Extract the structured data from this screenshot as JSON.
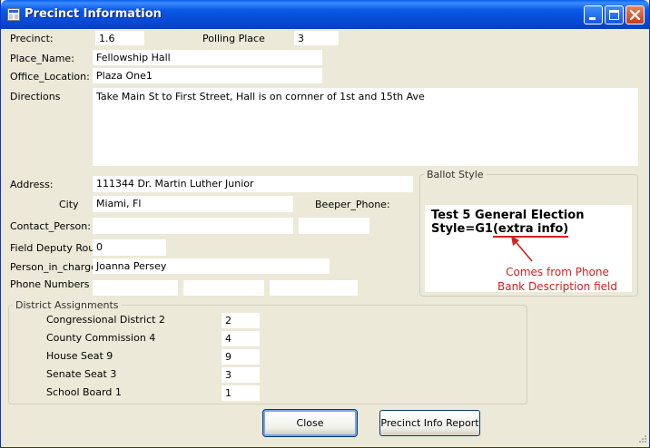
{
  "window": {
    "title": "Precinct Information"
  },
  "labels": {
    "precinct": "Precinct:",
    "polling_place": "Polling Place",
    "place_name": "Place_Name:",
    "office_location": "Office_Location:",
    "directions": "Directions",
    "address": "Address:",
    "city": "City",
    "beeper_phone": "Beeper_Phone:",
    "contact_person": "Contact_Person:",
    "field_deputy_route": "Field Deputy Route:",
    "person_in_charge": "Person_in_charge:",
    "phone_numbers": "Phone Numbers"
  },
  "fields": {
    "precinct": "1.6",
    "polling_place": "3",
    "place_name": "Fellowship Hall",
    "office_location": "Plaza One1",
    "directions": "Take Main St to First Street, Hall is on cornner of 1st and 15th Ave",
    "address": "111344  Dr. Martin Luther Junior",
    "city": "Miami, Fl",
    "beeper_phone": "",
    "contact_person": "",
    "contact_person_2": "",
    "field_deputy_route": "0",
    "person_in_charge": "Joanna Persey",
    "phone_1": "",
    "phone_2": "",
    "phone_3": ""
  },
  "ballot_style": {
    "group_title": "Ballot Style",
    "line1": "Test 5 General Election",
    "line2_prefix": "Style=G1",
    "line2_extra": "(extra info)",
    "annotation_line1": "Comes from Phone",
    "annotation_line2": "Bank Description field"
  },
  "district_assignments": {
    "group_title": "District Assignments",
    "rows": [
      {
        "label": "Congressional District 2",
        "value": "2"
      },
      {
        "label": "County Commission 4",
        "value": "4"
      },
      {
        "label": "House Seat 9",
        "value": "9"
      },
      {
        "label": "Senate Seat 3",
        "value": "3"
      },
      {
        "label": "School Board 1",
        "value": "1"
      }
    ]
  },
  "buttons": {
    "close": "Close",
    "report": "Precinct Info Report"
  },
  "colors": {
    "annotation": "#D42020",
    "titlebar": "#0A58E6",
    "dialog_bg": "#ECE9D8"
  }
}
